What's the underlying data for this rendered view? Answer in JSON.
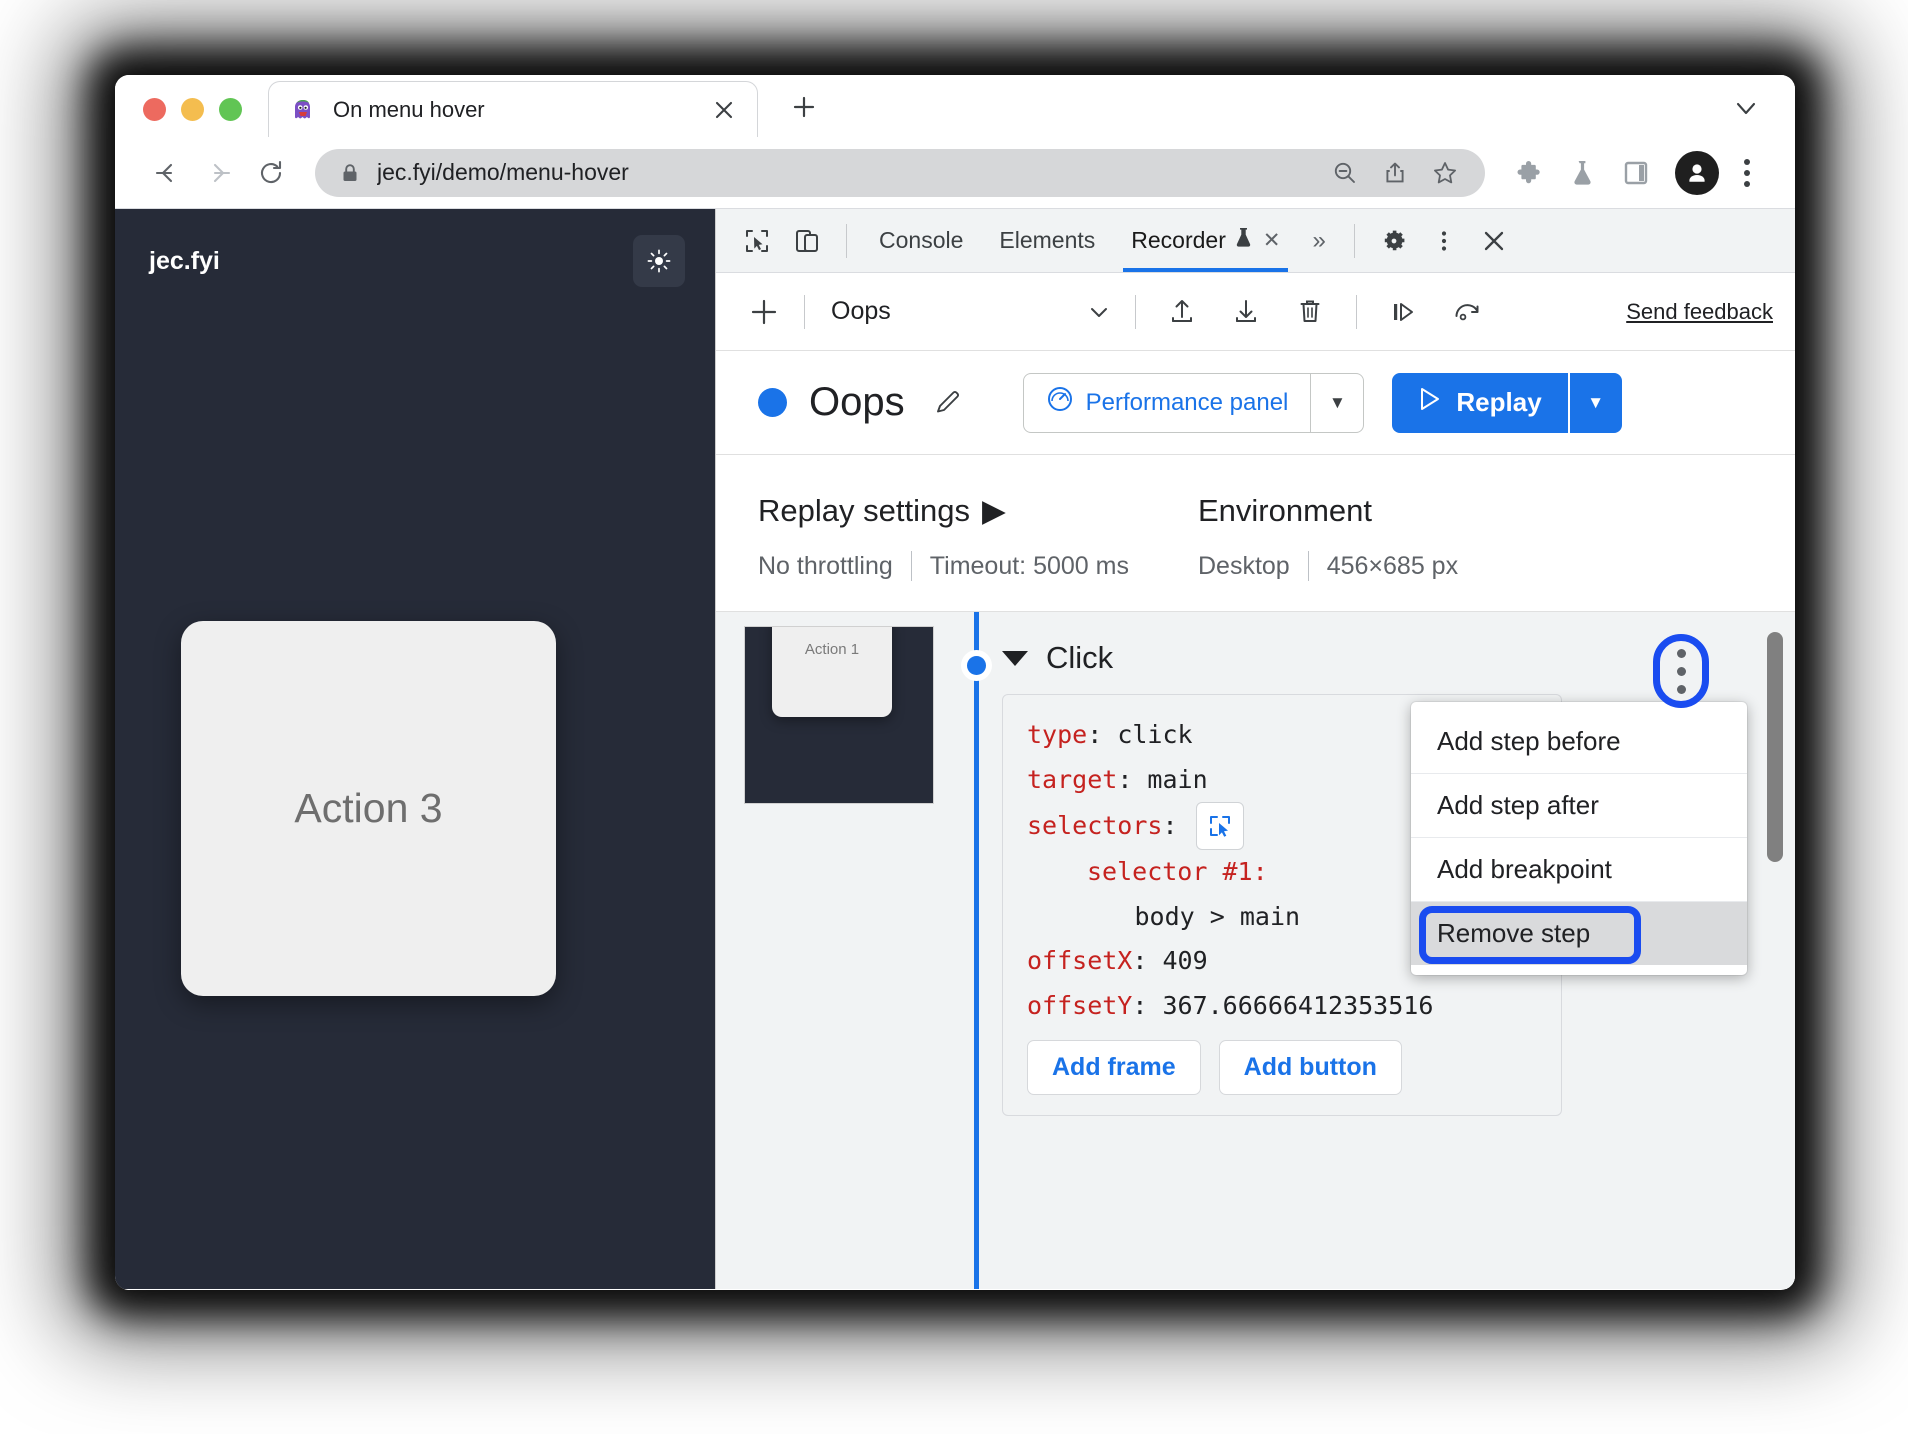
{
  "browser": {
    "tab": {
      "title": "On menu hover",
      "favicon_icon": "ghost-favicon",
      "close_icon": "close-icon"
    },
    "new_tab_icon": "plus-icon",
    "tablist_caret_icon": "chevron-down-icon",
    "nav": {
      "back_icon": "arrow-left-icon",
      "forward_icon": "arrow-right-icon",
      "reload_icon": "reload-icon"
    },
    "omnibox": {
      "lock_icon": "lock-icon",
      "url": "jec.fyi/demo/menu-hover",
      "zoom_out_icon": "zoom-out-icon",
      "share_icon": "share-icon",
      "bookmark_icon": "star-icon"
    },
    "toolbar_icons": [
      "extensions-puzzle-icon",
      "experiments-flask-icon",
      "side-panel-icon"
    ],
    "avatar_icon": "profile-avatar-icon",
    "menu_icon": "browser-kebab-icon"
  },
  "page": {
    "brand": "jec.fyi",
    "theme_toggle_icon": "sun-icon",
    "action_button_label": "Action 3"
  },
  "devtools": {
    "inspect_icon": "inspect-cursor-icon",
    "device_toolbar_icon": "device-toggle-icon",
    "tabs": [
      {
        "label": "Console",
        "active": false
      },
      {
        "label": "Elements",
        "active": false
      },
      {
        "label": "Recorder",
        "active": true,
        "experiment_icon": "flask-icon",
        "close_icon": "close-icon"
      }
    ],
    "overflow_icon": "chevron-double-right-icon",
    "settings_icon": "gear-icon",
    "kebab_icon": "devtools-kebab-icon",
    "close_icon": "devtools-close-icon"
  },
  "recorder_toolbar": {
    "add_icon": "plus-icon",
    "recording_name": "Oops",
    "dropdown_icon": "chevron-down-icon",
    "export_icon": "upload-icon",
    "import_icon": "download-icon",
    "delete_icon": "trash-icon",
    "step_by_step_icon": "step-over-icon",
    "replay_speed_icon": "replay-speed-icon",
    "feedback_label": "Send feedback"
  },
  "recording_header": {
    "status_dot_color": "#1a73e8",
    "title": "Oops",
    "edit_icon": "pencil-icon",
    "performance_panel": {
      "icon": "performance-icon",
      "label": "Performance panel",
      "arrow_icon": "triangle-down-icon"
    },
    "replay": {
      "icon": "play-icon",
      "label": "Replay",
      "arrow_icon": "triangle-down-icon"
    }
  },
  "settings": {
    "replay": {
      "heading": "Replay settings",
      "expand_icon": "triangle-right-icon",
      "throttling": "No throttling",
      "timeout": "Timeout: 5000 ms"
    },
    "environment": {
      "heading": "Environment",
      "device": "Desktop",
      "viewport": "456×685 px"
    }
  },
  "steps": {
    "thumbnail_label": "Action 1",
    "step_name": "Click",
    "expand_icon": "triangle-down-icon",
    "kebab_icon": "step-kebab-icon",
    "code": {
      "type_key": "type",
      "type_value": "click",
      "target_key": "target",
      "target_value": "main",
      "selectors_key": "selectors",
      "picker_icon": "selector-picker-icon",
      "selector1_key": "selector #1",
      "selector1_value": "body > main",
      "offsetx_key": "offsetX",
      "offsetx_value": "409",
      "offsety_key": "offsetY",
      "offsety_value": "367.66666412353516"
    },
    "add_frame_label": "Add frame",
    "add_button_label": "Add button"
  },
  "context_menu": {
    "items": [
      {
        "label": "Add step before",
        "highlighted": false
      },
      {
        "label": "Add step after",
        "highlighted": false
      },
      {
        "label": "Add breakpoint",
        "highlighted": false
      },
      {
        "label": "Remove step",
        "highlighted": true
      }
    ],
    "highlight_color": "#1a4cf0"
  }
}
